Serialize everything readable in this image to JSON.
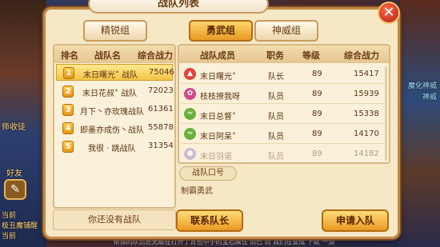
{
  "window": {
    "title": "战队列表"
  },
  "tabs": [
    {
      "label": "精锐组",
      "active": false
    },
    {
      "label": "勇武组",
      "active": true
    },
    {
      "label": "神威组",
      "active": false
    }
  ],
  "team_list": {
    "headers": {
      "rank": "排名",
      "name": "战队名",
      "power": "综合战力"
    },
    "rows": [
      {
        "rank": "1",
        "name": "末日曙光˚ 战队",
        "power": "75046",
        "selected": true
      },
      {
        "rank": "2",
        "name": "末日花叔˚ 战队",
        "power": "72023",
        "selected": false
      },
      {
        "rank": "3",
        "name": "月下丶亦玫瑰战队",
        "power": "61361",
        "selected": false
      },
      {
        "rank": "4",
        "name": "即墨亦成伤丶战队",
        "power": "55878",
        "selected": false
      },
      {
        "rank": "5",
        "name": "我很 · 跳战队",
        "power": "31354",
        "selected": false
      }
    ],
    "no_team_text": "你还没有战队"
  },
  "member_list": {
    "headers": {
      "member": "战队成员",
      "role": "职务",
      "level": "等级",
      "power": "综合战力"
    },
    "rows": [
      {
        "icon": "fire-icon",
        "icon_color": "#e0443a",
        "name": "末日曙光˚",
        "role": "队长",
        "level": "89",
        "power": "15417"
      },
      {
        "icon": "flower-icon",
        "icon_color": "#d04a8a",
        "name": "枝枝撩我呀",
        "role": "队员",
        "level": "89",
        "power": "15939"
      },
      {
        "icon": "wind-icon",
        "icon_color": "#6ab03a",
        "name": "末日总督˚",
        "role": "队员",
        "level": "89",
        "power": "15338"
      },
      {
        "icon": "wind-icon",
        "icon_color": "#6ab03a",
        "name": "末日阿呆˚",
        "role": "队员",
        "level": "89",
        "power": "14170"
      },
      {
        "icon": "spirit-icon",
        "icon_color": "#8a7ad0",
        "name": "末日羽诺",
        "role": "队员",
        "level": "89",
        "power": "14182"
      }
    ]
  },
  "slogan": {
    "label": "战队口号",
    "text": "制霸勇武"
  },
  "buttons": {
    "contact_captain": "联系队长",
    "apply_join": "申请入队"
  },
  "background": {
    "left_texts": [
      "师收徒",
      "好友",
      "当前",
      "极丑魔铺醒",
      "当前"
    ],
    "right_texts": [
      "魔化神威",
      "神威"
    ],
    "ticker": "帮派的队员还无敌在打开了背包中子的宝石属性 而已 而 我们在变成 下就 一派"
  }
}
